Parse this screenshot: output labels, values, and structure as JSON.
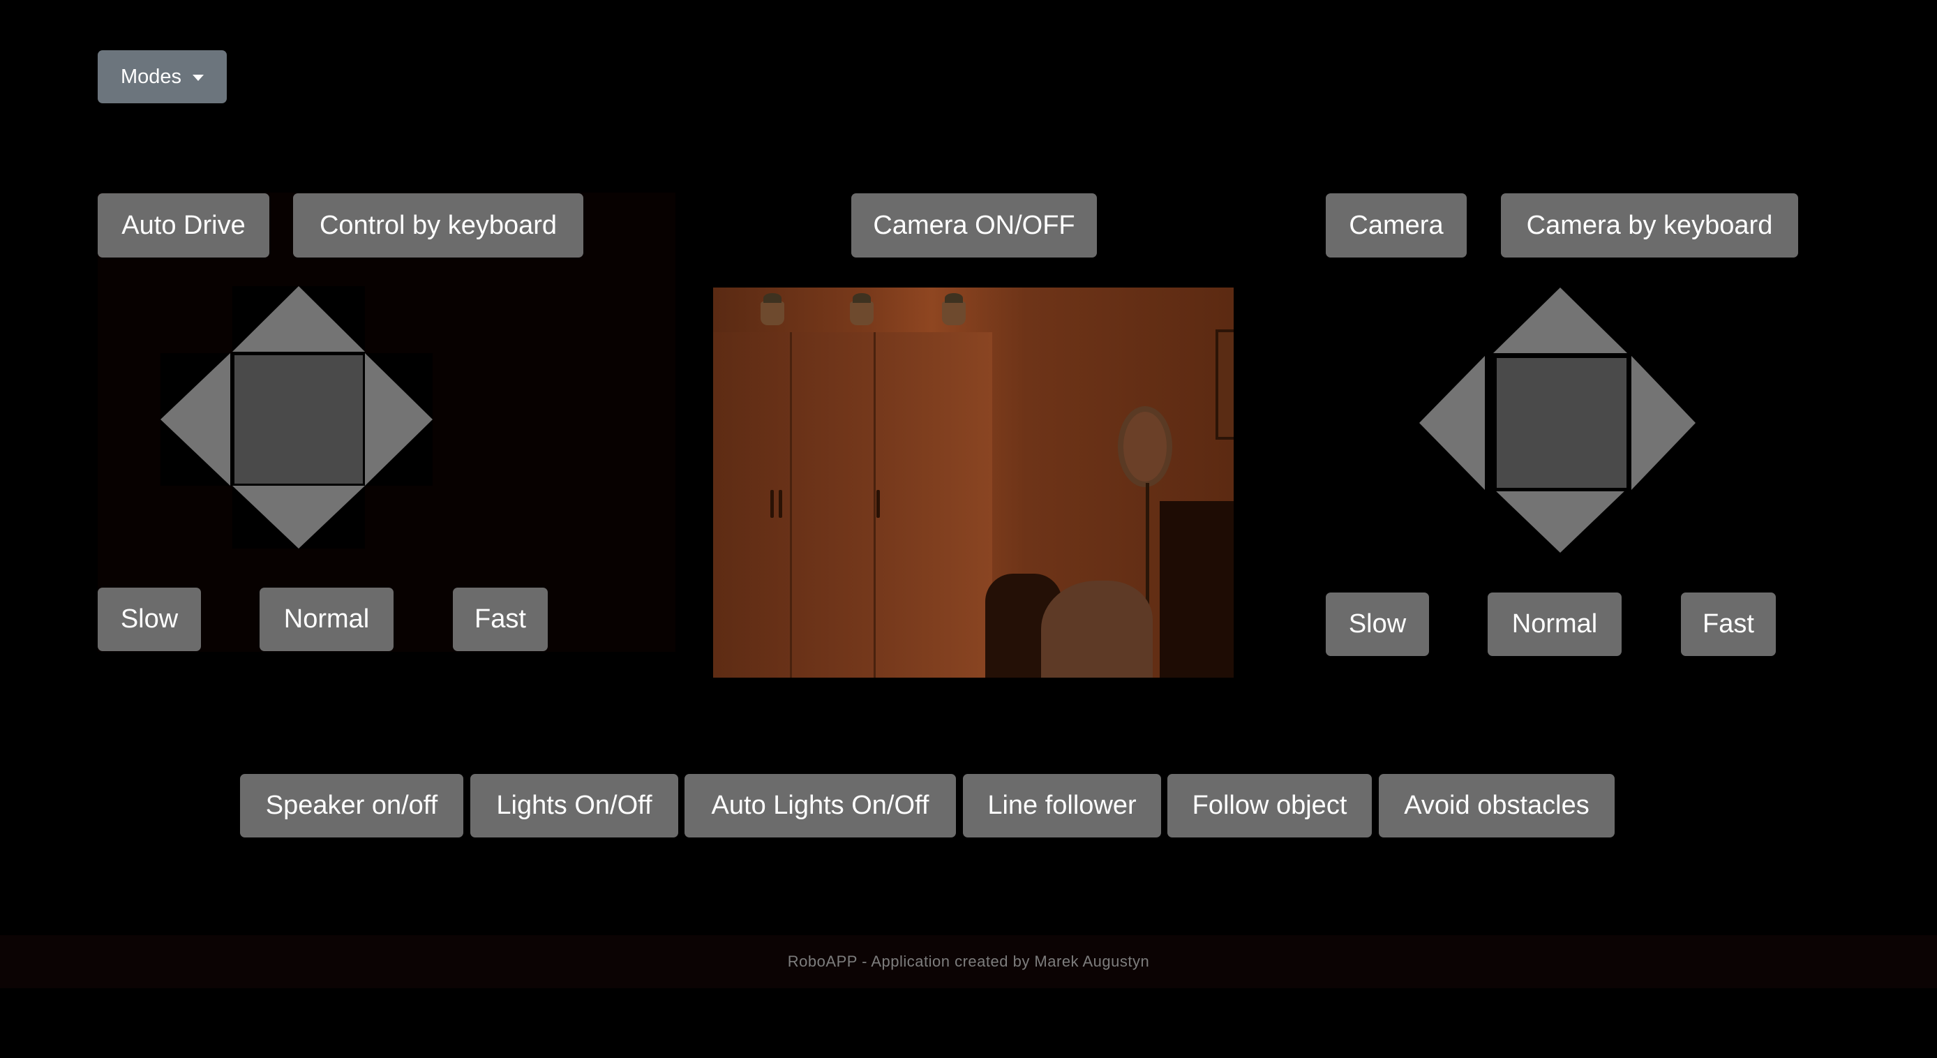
{
  "modes_dropdown": {
    "label": "Modes"
  },
  "drive_panel": {
    "buttons": {
      "auto_drive": "Auto Drive",
      "control_by_keyboard": "Control by keyboard"
    },
    "speed": {
      "slow": "Slow",
      "normal": "Normal",
      "fast": "Fast"
    }
  },
  "camera_center": {
    "toggle_label": "Camera ON/OFF"
  },
  "camera_panel": {
    "buttons": {
      "camera": "Camera",
      "camera_by_keyboard": "Camera by keyboard"
    },
    "speed": {
      "slow": "Slow",
      "normal": "Normal",
      "fast": "Fast"
    }
  },
  "bottom_bar": {
    "buttons": [
      "Speaker on/off",
      "Lights On/Off",
      "Auto Lights On/Off",
      "Line follower",
      "Follow object",
      "Avoid obstacles"
    ]
  },
  "footer": {
    "text": "RoboAPP - Application created by Marek Augustyn"
  },
  "colors": {
    "background": "#000000",
    "button": "#6c6c6c",
    "dropdown": "#6c757d",
    "dpad_arrow": "#747474",
    "dpad_center": "#4a4a4a"
  },
  "icons": [
    "caret-down-icon",
    "arrow-up-icon",
    "arrow-down-icon",
    "arrow-left-icon",
    "arrow-right-icon"
  ]
}
